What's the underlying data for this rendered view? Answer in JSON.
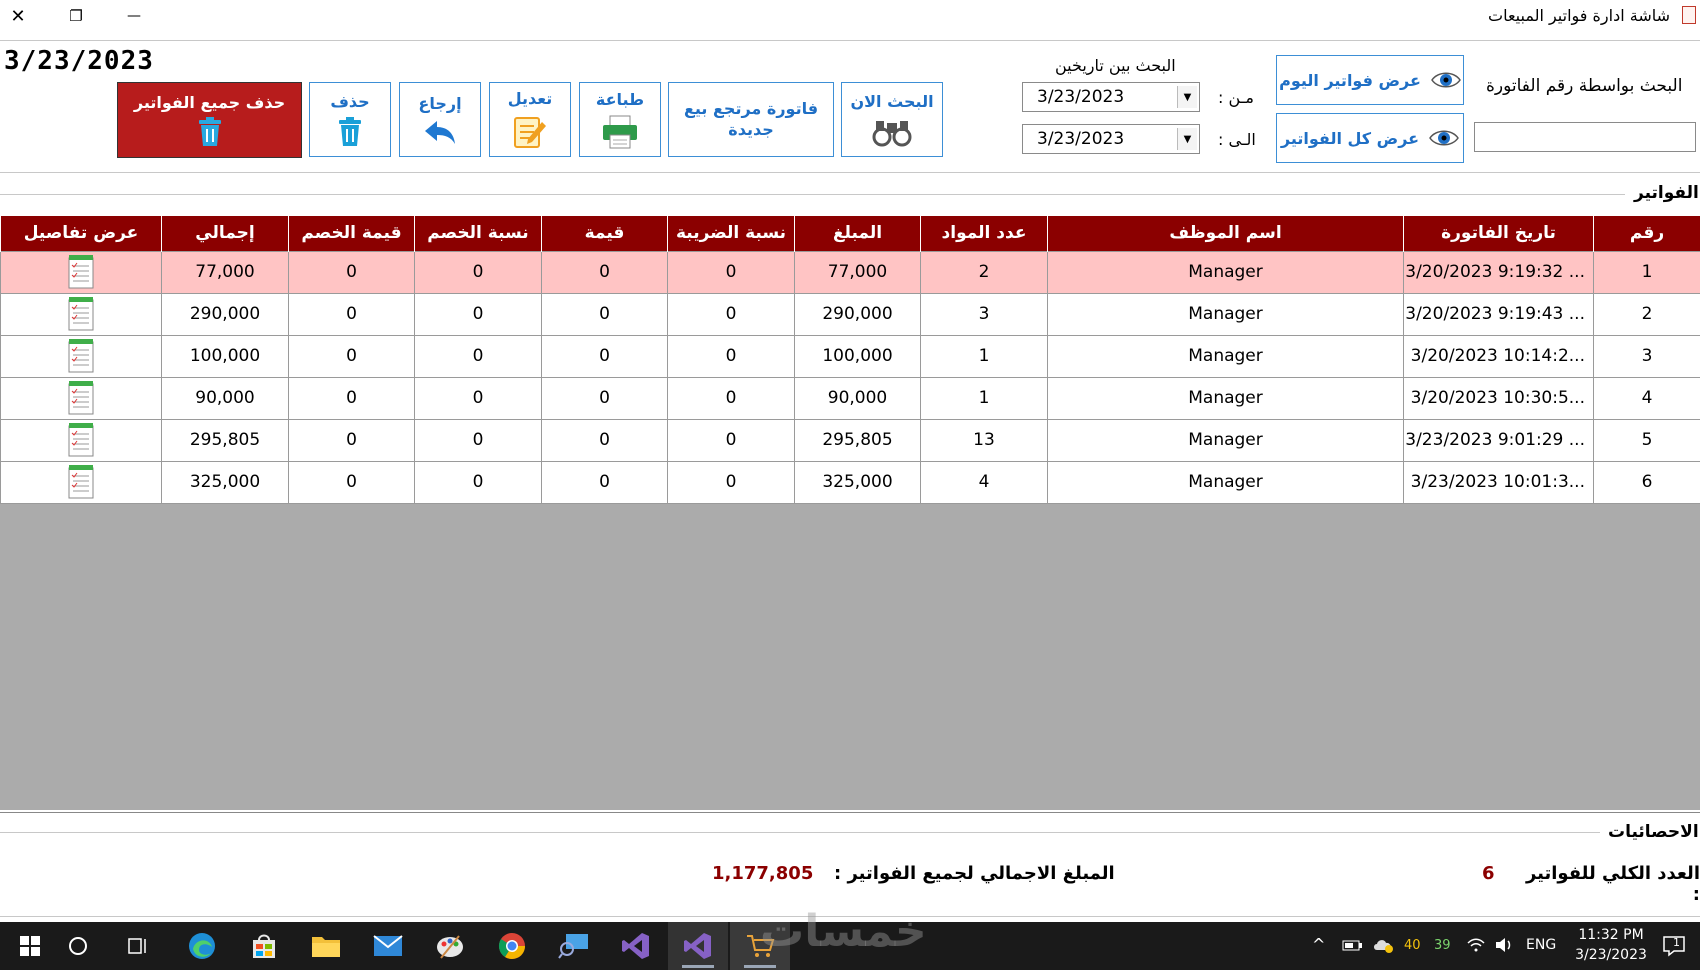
{
  "window": {
    "title": "شاشة ادارة فواتير المبيعات",
    "close_symbol": "✕",
    "restore_symbol": "❐",
    "minimize_symbol": "—"
  },
  "current_date": "3/23/2023",
  "toolbar": {
    "delete_all_label": "حذف جميع الفواتير",
    "delete_label": "حذف",
    "return_label": "إرجاع",
    "edit_label": "تعديل",
    "print_label": "طباعة",
    "new_return_label": "فاتورة مرتجع بيع جديدة",
    "search_now_label": "البحث الان"
  },
  "date_search": {
    "title": "البحث بين تاريخين",
    "from_label": "مـن :",
    "to_label": "الـى :",
    "from_value": "3/23/2023",
    "to_value": "3/23/2023"
  },
  "view_buttons": {
    "today_label": "عرض فواتير اليوم",
    "all_label": "عرض كل الفواتير"
  },
  "invoice_search": {
    "label": "البحث بواسطة رقم الفاتورة",
    "value": ""
  },
  "invoices_section_title": "الفواتير",
  "table": {
    "columns": [
      "رقم",
      "تاريخ الفاتورة",
      "اسم الموظف",
      "عدد المواد",
      "المبلغ",
      "نسبة الضريبة",
      "قيمة",
      "نسبة الخصم",
      "قيمة الخصم",
      "إجمالي",
      "عرض تفاصيل"
    ],
    "rows": [
      {
        "no": "1",
        "date": "3/20/2023 9:19:32 ...",
        "employee": "Manager",
        "items": "2",
        "amount": "77,000",
        "tax_rate": "0",
        "value": "0",
        "discount_rate": "0",
        "discount_value": "0",
        "total": "77,000"
      },
      {
        "no": "2",
        "date": "3/20/2023 9:19:43 ...",
        "employee": "Manager",
        "items": "3",
        "amount": "290,000",
        "tax_rate": "0",
        "value": "0",
        "discount_rate": "0",
        "discount_value": "0",
        "total": "290,000"
      },
      {
        "no": "3",
        "date": "3/20/2023 10:14:2...",
        "employee": "Manager",
        "items": "1",
        "amount": "100,000",
        "tax_rate": "0",
        "value": "0",
        "discount_rate": "0",
        "discount_value": "0",
        "total": "100,000"
      },
      {
        "no": "4",
        "date": "3/20/2023 10:30:5...",
        "employee": "Manager",
        "items": "1",
        "amount": "90,000",
        "tax_rate": "0",
        "value": "0",
        "discount_rate": "0",
        "discount_value": "0",
        "total": "90,000"
      },
      {
        "no": "5",
        "date": "3/23/2023 9:01:29 ...",
        "employee": "Manager",
        "items": "13",
        "amount": "295,805",
        "tax_rate": "0",
        "value": "0",
        "discount_rate": "0",
        "discount_value": "0",
        "total": "295,805"
      },
      {
        "no": "6",
        "date": "3/23/2023 10:01:3...",
        "employee": "Manager",
        "items": "4",
        "amount": "325,000",
        "tax_rate": "0",
        "value": "0",
        "discount_rate": "0",
        "discount_value": "0",
        "total": "325,000"
      }
    ]
  },
  "stats": {
    "section_title": "الاحصائيات",
    "count_label": "العدد الكلي للفواتير :",
    "count_value": "6",
    "total_label": "المبلغ الاجمالي لجميع الفواتير :",
    "total_value": "1,177,805"
  },
  "taskbar": {
    "time": "11:32 PM",
    "date": "3/23/2023",
    "lang": "ENG",
    "tray_num_1": "40",
    "tray_num_2": "39",
    "notification_count": "1",
    "watermark": "خمسات"
  },
  "colors": {
    "header_bg": "#8b0000",
    "selected_row": "#ffc4c4",
    "delete_all_bg": "#b71c1c",
    "accent_blue": "#1f6fc5",
    "grid_empty": "#ababab"
  }
}
